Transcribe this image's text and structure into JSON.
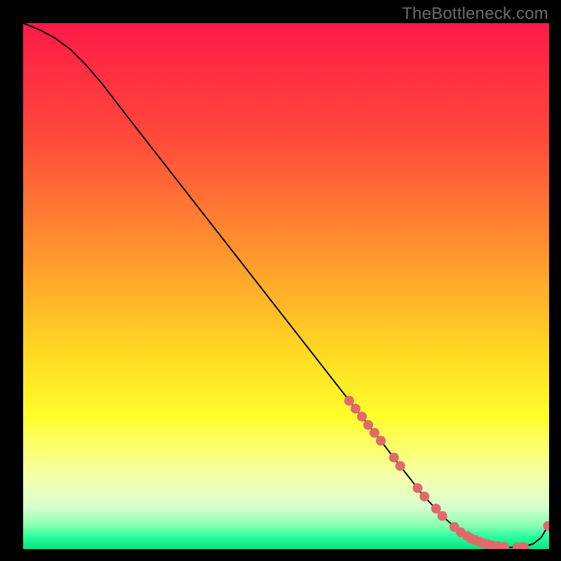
{
  "watermark": "TheBottleneck.com",
  "chart_data": {
    "type": "line",
    "title": "",
    "xlabel": "",
    "ylabel": "",
    "xlim": [
      0,
      100
    ],
    "ylim": [
      0,
      100
    ],
    "grid": false,
    "legend": false,
    "background_gradient": {
      "stops": [
        {
          "pos": 0.0,
          "color": "#ff1a47"
        },
        {
          "pos": 0.22,
          "color": "#ff4a3a"
        },
        {
          "pos": 0.45,
          "color": "#ff9a2d"
        },
        {
          "pos": 0.62,
          "color": "#ffd722"
        },
        {
          "pos": 0.75,
          "color": "#ffff2b"
        },
        {
          "pos": 0.86,
          "color": "#f6ffa8"
        },
        {
          "pos": 0.92,
          "color": "#d7ffce"
        },
        {
          "pos": 0.955,
          "color": "#8affb1"
        },
        {
          "pos": 0.975,
          "color": "#2dffa0"
        },
        {
          "pos": 1.0,
          "color": "#05e57e"
        }
      ]
    },
    "series": [
      {
        "name": "bottleneck-curve",
        "color": "#000000",
        "x": [
          0,
          3,
          6,
          9,
          12,
          15,
          20,
          30,
          40,
          50,
          60,
          68,
          72,
          76,
          80,
          83,
          86,
          89,
          92,
          95,
          97,
          98.5,
          99.8
        ],
        "y": [
          100,
          98.8,
          97.2,
          95.0,
          92.0,
          88.5,
          82.0,
          69.2,
          56.4,
          43.6,
          30.8,
          20.6,
          15.4,
          10.3,
          6.0,
          3.4,
          1.7,
          0.7,
          0.3,
          0.4,
          1.0,
          2.2,
          4.4
        ]
      }
    ],
    "markers": {
      "name": "highlight-dots",
      "color": "#e06a6a",
      "radius_px": 7,
      "points": [
        {
          "x": 62,
          "y": 28.2
        },
        {
          "x": 63.2,
          "y": 26.7
        },
        {
          "x": 64.4,
          "y": 25.2
        },
        {
          "x": 65.6,
          "y": 23.6
        },
        {
          "x": 66.8,
          "y": 22.1
        },
        {
          "x": 68,
          "y": 20.6
        },
        {
          "x": 70.5,
          "y": 17.4
        },
        {
          "x": 71.7,
          "y": 15.8
        },
        {
          "x": 75,
          "y": 11.6
        },
        {
          "x": 76.3,
          "y": 10.0
        },
        {
          "x": 78.5,
          "y": 7.7
        },
        {
          "x": 79.7,
          "y": 6.3
        },
        {
          "x": 82,
          "y": 4.2
        },
        {
          "x": 83.2,
          "y": 3.2
        },
        {
          "x": 84.4,
          "y": 2.5
        },
        {
          "x": 85.2,
          "y": 2.0
        },
        {
          "x": 86,
          "y": 1.7
        },
        {
          "x": 86.8,
          "y": 1.4
        },
        {
          "x": 87.6,
          "y": 1.1
        },
        {
          "x": 88.4,
          "y": 0.9
        },
        {
          "x": 89.2,
          "y": 0.7
        },
        {
          "x": 90.2,
          "y": 0.55
        },
        {
          "x": 91.5,
          "y": 0.4
        },
        {
          "x": 94,
          "y": 0.35
        },
        {
          "x": 95.2,
          "y": 0.4
        },
        {
          "x": 99.8,
          "y": 4.4
        }
      ]
    }
  }
}
